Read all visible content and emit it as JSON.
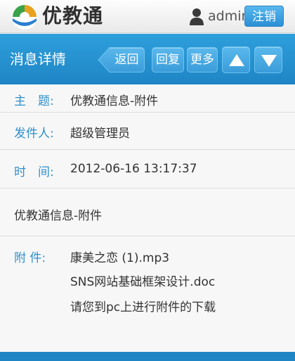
{
  "header": {
    "app_title": "优教通",
    "username": "admin",
    "logout_label": "注销"
  },
  "toolbar": {
    "title": "消息详情",
    "back_label": "返回",
    "reply_label": "回复",
    "more_label": "更多"
  },
  "message": {
    "subject_label": "主　题:",
    "subject": "优教通信息-附件",
    "sender_label": "发件人:",
    "sender": "超级管理员",
    "time_label": "时　间:",
    "time": "2012-06-16 13:17:37",
    "body": "优教通信息-附件",
    "attachments_label": "附 件:",
    "attachments": [
      "康美之恋 (1).mp3",
      "SNS网站基础框架设计.doc"
    ],
    "attachment_note": "请您到pc上进行附件的下载"
  },
  "colors": {
    "brand_blue": "#2a93d5",
    "label_blue": "#2e8fcc"
  }
}
